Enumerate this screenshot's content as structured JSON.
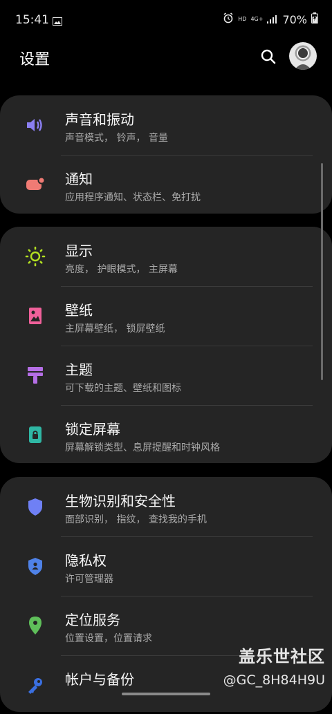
{
  "status_bar": {
    "time": "15:41",
    "hd": "HD",
    "network": "4G+",
    "battery": "70%"
  },
  "header": {
    "title": "设置"
  },
  "groups": [
    [
      {
        "title": "声音和振动",
        "subtitle": "声音模式， 铃声， 音量",
        "icon": "speaker-icon",
        "color": "#8b7ff2"
      },
      {
        "title": "通知",
        "subtitle": "应用程序通知、状态栏、免打扰",
        "icon": "notification-icon",
        "color": "#f07b74"
      }
    ],
    [
      {
        "title": "显示",
        "subtitle": "亮度， 护眼模式， 主屏幕",
        "icon": "brightness-icon",
        "color": "#b3e021"
      },
      {
        "title": "壁纸",
        "subtitle": "主屏幕壁纸， 锁屏壁纸",
        "icon": "wallpaper-icon",
        "color": "#f0609a"
      },
      {
        "title": "主题",
        "subtitle": "可下载的主题、壁纸和图标",
        "icon": "theme-brush-icon",
        "color": "#b56ee6"
      },
      {
        "title": "锁定屏幕",
        "subtitle": "屏幕解锁类型、息屏提醒和时钟风格",
        "icon": "lock-screen-icon",
        "color": "#2fb7a4"
      }
    ],
    [
      {
        "title": "生物识别和安全性",
        "subtitle": "面部识别， 指纹， 查找我的手机",
        "icon": "shield-icon",
        "color": "#6f80f5"
      },
      {
        "title": "隐私权",
        "subtitle": "许可管理器",
        "icon": "privacy-shield-icon",
        "color": "#4f82e8"
      },
      {
        "title": "定位服务",
        "subtitle": "位置设置，位置请求",
        "icon": "location-pin-icon",
        "color": "#5fbf5a"
      },
      {
        "title": "帐户与备份",
        "subtitle": "",
        "icon": "key-icon",
        "color": "#3a6fe0"
      }
    ]
  ],
  "watermark": {
    "brand": "盖乐世社区",
    "user": "@GC_8H84H9U"
  }
}
